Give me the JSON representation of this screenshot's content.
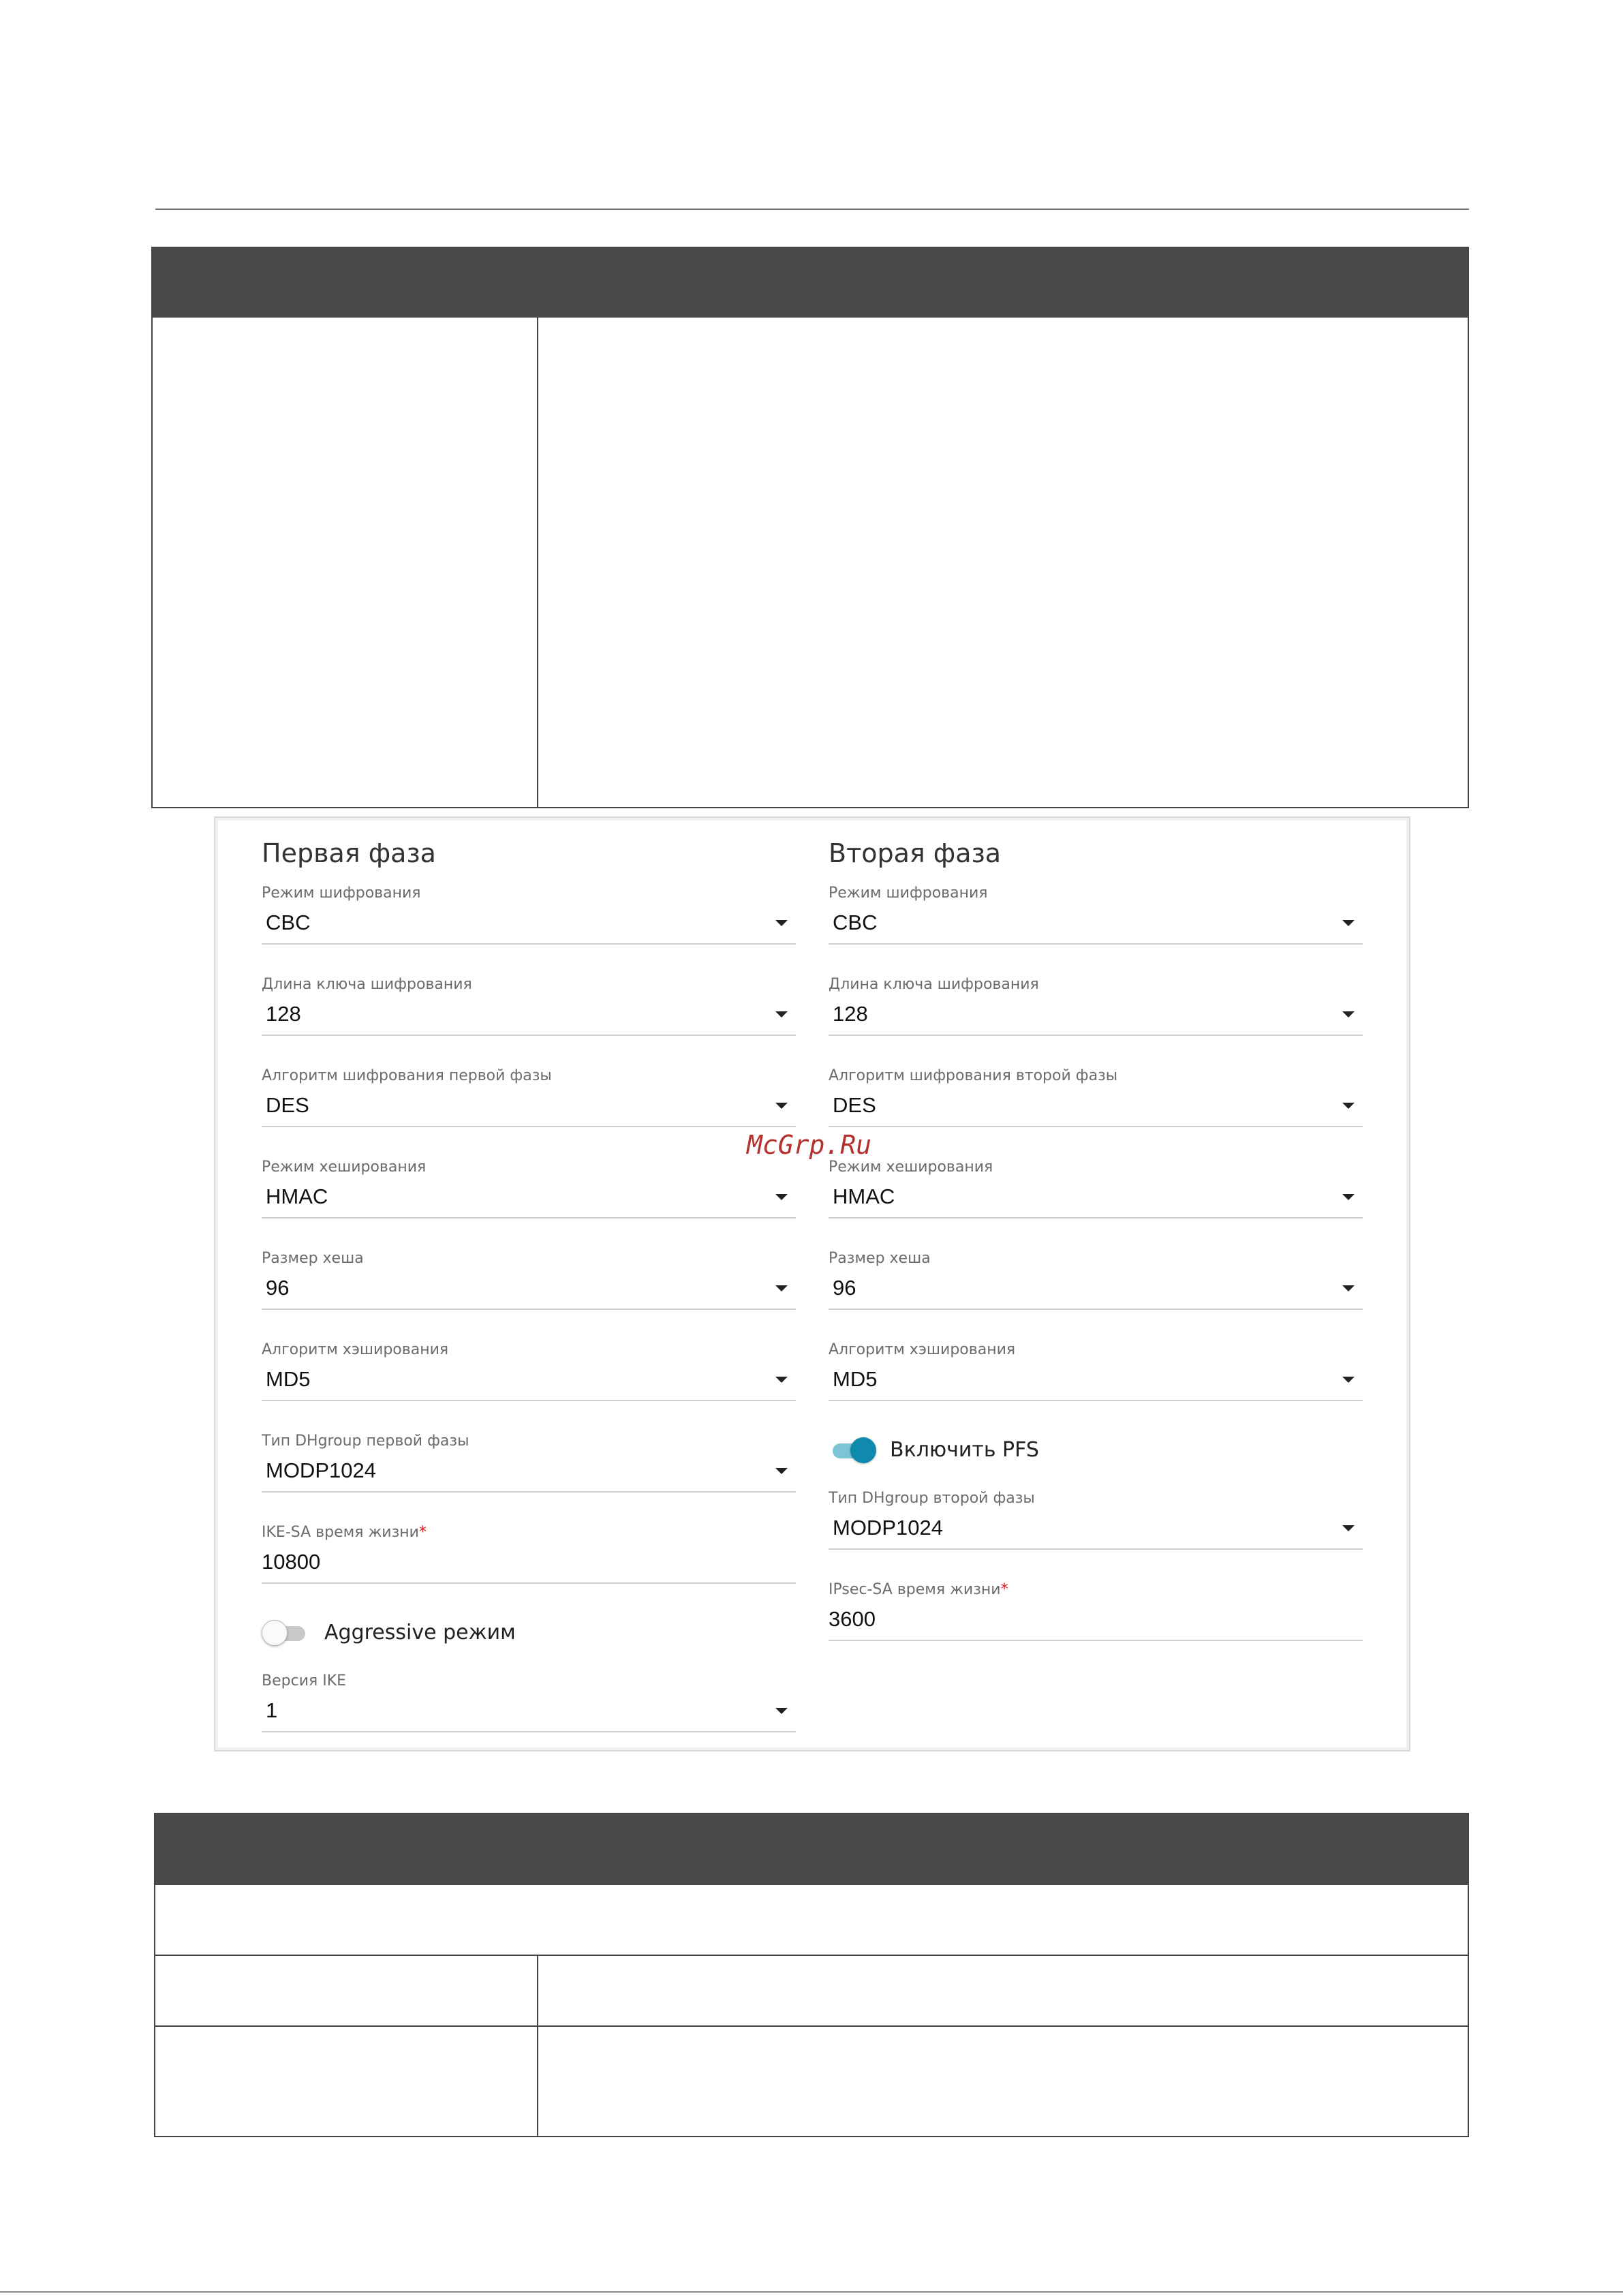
{
  "watermark": "McGrp.Ru",
  "phase1": {
    "title": "Первая фаза",
    "fields": [
      {
        "label": "Режим шифрования",
        "value": "CBC"
      },
      {
        "label": "Длина ключа шифрования",
        "value": "128"
      },
      {
        "label": "Алгоритм шифрования первой фазы",
        "value": "DES"
      },
      {
        "label": "Режим хеширования",
        "value": "HMAC"
      },
      {
        "label": "Размер хеша",
        "value": "96"
      },
      {
        "label": "Алгоритм хэширования",
        "value": "MD5"
      },
      {
        "label": "Тип DHgroup первой фазы",
        "value": "MODP1024"
      }
    ],
    "ike_lifetime": {
      "label": "IKE-SA время жизни",
      "required": "*",
      "value": "10800"
    },
    "aggressive": {
      "label": "Aggressive режим",
      "state": "off"
    },
    "ike_version": {
      "label": "Версия IKE",
      "value": "1"
    }
  },
  "phase2": {
    "title": "Вторая фаза",
    "fields": [
      {
        "label": "Режим шифрования",
        "value": "CBC"
      },
      {
        "label": "Длина ключа шифрования",
        "value": "128"
      },
      {
        "label": "Алгоритм шифрования второй фазы",
        "value": "DES"
      },
      {
        "label": "Режим хеширования",
        "value": "HMAC"
      },
      {
        "label": "Размер хеша",
        "value": "96"
      },
      {
        "label": "Алгоритм хэширования",
        "value": "MD5"
      }
    ],
    "pfs": {
      "label": "Включить PFS",
      "state": "on"
    },
    "dh_group": {
      "label": "Тип DHgroup второй фазы",
      "value": "MODP1024"
    },
    "ipsec_lifetime": {
      "label": "IPsec-SA время жизни",
      "required": "*",
      "value": "3600"
    }
  },
  "colors": {
    "toggle_on": "#0f89ad",
    "table_header": "#4a4a4a",
    "required_mark": "#e01b1b"
  }
}
